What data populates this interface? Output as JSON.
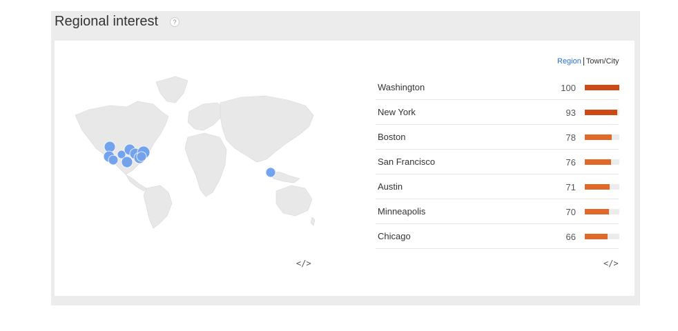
{
  "section": {
    "title": "Regional interest",
    "help_glyph": "?"
  },
  "toggle": {
    "region_label": "Region",
    "city_label": "Town/City",
    "active": "Region"
  },
  "embed_glyph": "</>",
  "regions": [
    {
      "name": "Washington",
      "value": 100,
      "color": "#cc4a14"
    },
    {
      "name": "New York",
      "value": 93,
      "color": "#cc4a14"
    },
    {
      "name": "Boston",
      "value": 78,
      "color": "#e0692a"
    },
    {
      "name": "San Francisco",
      "value": 76,
      "color": "#e0692a"
    },
    {
      "name": "Austin",
      "value": 71,
      "color": "#e0692a"
    },
    {
      "name": "Minneapolis",
      "value": 70,
      "color": "#e0692a"
    },
    {
      "name": "Chicago",
      "value": 66,
      "color": "#e0692a"
    }
  ],
  "map": {
    "land_color": "#e8e8e8",
    "bubble_color": "#6ea0ef"
  }
}
